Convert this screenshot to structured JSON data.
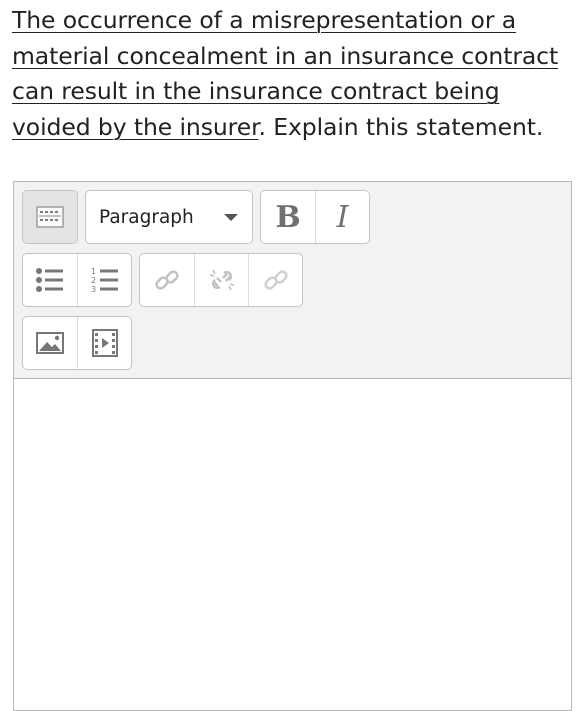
{
  "question": {
    "underlined_text": "The occurrence of a misrepresentation or a material concealment in an insurance contract can result in the insurance contract being voided by the insurer",
    "trailing_text": ". Explain this statement."
  },
  "editor": {
    "toolbar": {
      "format_select": {
        "selected": "Paragraph"
      },
      "bold": {
        "label": "B"
      },
      "italic": {
        "label": "I"
      }
    },
    "content": ""
  }
}
